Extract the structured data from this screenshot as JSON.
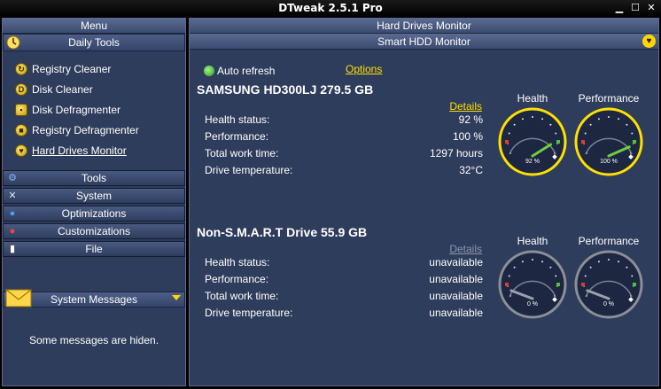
{
  "app": {
    "title": "DTweak 2.5.1 Pro"
  },
  "window_buttons": [
    "minimize-button",
    "maximize-button",
    "close-button"
  ],
  "left": {
    "menu_title": "Menu",
    "daily_tools": {
      "label": "Daily Tools",
      "items": [
        {
          "label": "Registry Cleaner",
          "icon": "registry-cleaner-icon"
        },
        {
          "label": "Disk Cleaner",
          "icon": "disk-cleaner-icon"
        },
        {
          "label": "Disk Defragmenter",
          "icon": "disk-defragmenter-icon"
        },
        {
          "label": "Registry Defragmenter",
          "icon": "registry-defragmenter-icon"
        },
        {
          "label": "Hard Drives Monitor",
          "icon": "heart-icon",
          "active": true
        }
      ]
    },
    "categories": [
      {
        "label": "Tools",
        "icon": "gear-icon"
      },
      {
        "label": "System",
        "icon": "wrench-icon"
      },
      {
        "label": "Optimizations",
        "icon": "rocket-icon"
      },
      {
        "label": "Customizations",
        "icon": "paint-icon"
      },
      {
        "label": "File",
        "icon": "file-icon"
      }
    ],
    "system_messages": {
      "title": "System Messages",
      "message": "Some messages are hiden."
    }
  },
  "right": {
    "title": "Hard Drives Monitor",
    "subtitle": "Smart HDD Monitor",
    "auto_refresh": "Auto refresh",
    "options": "Options",
    "field_labels": {
      "health": "Health status:",
      "performance": "Performance:",
      "work_time": "Total work time:",
      "temperature": "Drive temperature:"
    },
    "gauge_labels": {
      "health": "Health",
      "performance": "Performance"
    },
    "drives": [
      {
        "name": "SAMSUNG HD300LJ 279.5 GB",
        "details": "Details",
        "details_enabled": true,
        "health": "92 %",
        "performance": "100 %",
        "work_time": "1297 hours",
        "temperature": "32°C",
        "gauge_health_text": "92 %",
        "gauge_perf_text": "100 %",
        "gauge_health_value": 92,
        "gauge_perf_value": 100,
        "gauge_active": true
      },
      {
        "name": "Non-S.M.A.R.T Drive 55.9 GB",
        "details": "Details",
        "details_enabled": false,
        "health": "unavailable",
        "performance": "unavailable",
        "work_time": "unavailable",
        "temperature": "unavailable",
        "gauge_health_text": "0 %",
        "gauge_perf_text": "0 %",
        "gauge_health_value": 0,
        "gauge_perf_value": 0,
        "gauge_active": false
      }
    ]
  },
  "colors": {
    "panel": "#2f3d5c",
    "accent_yellow": "#ffdf00",
    "gauge_active_ring": "#ffe100",
    "gauge_inactive_ring": "#8a8f98",
    "needle_green": "#6bd13a",
    "needle_gray": "#9ba2ad"
  }
}
